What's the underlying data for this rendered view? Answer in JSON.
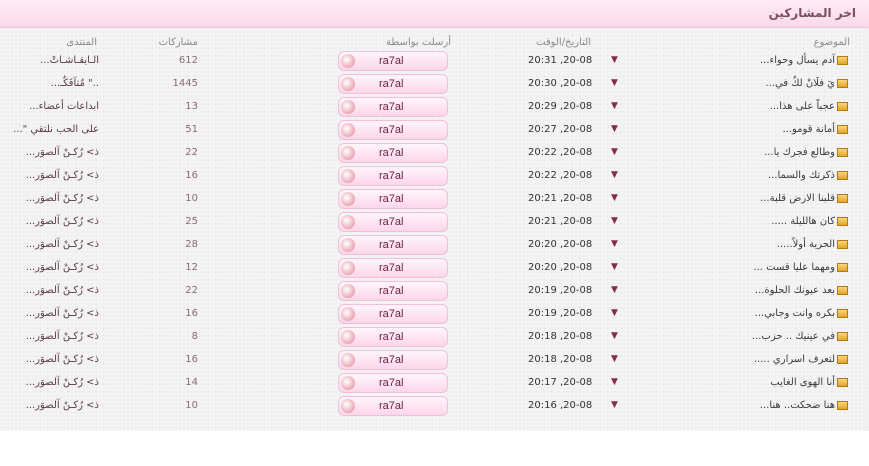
{
  "title": "اخر المشاركين",
  "headers": {
    "topic": "الموضوع",
    "datetime": "التاريخ/الوقت",
    "sent_by": "أرسلت بواسطة",
    "posts": "مشاركات",
    "forum": "المنتدى"
  },
  "rows": [
    {
      "topic": "آدم يسأل وحواء...",
      "date": "20:31 ,20-08",
      "user": "ra7al",
      "posts": "612",
      "forum": "الـايقـاشـاتْ..."
    },
    {
      "topic": "يَ فلَانْ لكٌ في...",
      "date": "20:30 ,20-08",
      "user": "ra7al",
      "posts": "1445",
      "forum": "..\" مٌتآفَكٌـ..."
    },
    {
      "topic": "عجباً على هذا...",
      "date": "20:29 ,20-08",
      "user": "ra7al",
      "posts": "13",
      "forum": "ابداعات أعضاء..."
    },
    {
      "topic": "أمانة قومو...",
      "date": "20:27 ,20-08",
      "user": "ra7al",
      "posts": "51",
      "forum": "على الحب نلتقي \"..."
    },
    {
      "topic": "وطالع فجرك يا...",
      "date": "20:22 ,20-08",
      "user": "ra7al",
      "posts": "22",
      "forum": "ذ> رُكـنْ آلصوَر..."
    },
    {
      "topic": "ذكرتك والسما...",
      "date": "20:22 ,20-08",
      "user": "ra7al",
      "posts": "16",
      "forum": "ذ> رُكـنْ آلصوَر..."
    },
    {
      "topic": "قلبنا الارض قلبة...",
      "date": "20:21 ,20-08",
      "user": "ra7al",
      "posts": "10",
      "forum": "ذ> رُكـنْ آلصوَر..."
    },
    {
      "topic": "كان هالليلة .....",
      "date": "20:21 ,20-08",
      "user": "ra7al",
      "posts": "25",
      "forum": "ذ> رُكـنْ آلصوَر..."
    },
    {
      "topic": "الحرية أولاً.....",
      "date": "20:20 ,20-08",
      "user": "ra7al",
      "posts": "28",
      "forum": "ذ> رُكـنْ آلصوَر..."
    },
    {
      "topic": "ومهما عليا قست ...",
      "date": "20:20 ,20-08",
      "user": "ra7al",
      "posts": "12",
      "forum": "ذ> رُكـنْ آلصوَر..."
    },
    {
      "topic": "بعد عيونك الحلوة...",
      "date": "20:19 ,20-08",
      "user": "ra7al",
      "posts": "22",
      "forum": "ذ> رُكـنْ آلصوَر..."
    },
    {
      "topic": "بكره وانت وجابي...",
      "date": "20:19 ,20-08",
      "user": "ra7al",
      "posts": "16",
      "forum": "ذ> رُكـنْ آلصوَر..."
    },
    {
      "topic": "في عينيك .. حزب...",
      "date": "20:18 ,20-08",
      "user": "ra7al",
      "posts": "8",
      "forum": "ذ> رُكـنْ آلصوَر..."
    },
    {
      "topic": "لتعرف اسراري .....",
      "date": "20:18 ,20-08",
      "user": "ra7al",
      "posts": "16",
      "forum": "ذ> رُكـنْ آلصوَر..."
    },
    {
      "topic": "أنا الهوى الغايب",
      "date": "20:17 ,20-08",
      "user": "ra7al",
      "posts": "14",
      "forum": "ذ> رُكـنْ آلصوَر..."
    },
    {
      "topic": "هنا ضحكت.. هنا...",
      "date": "20:16 ,20-08",
      "user": "ra7al",
      "posts": "10",
      "forum": "ذ> رُكـنْ آلصوَر..."
    }
  ],
  "arrow_glyph": "▼",
  "icons": {
    "topic": "folder-icon",
    "latest": "arrow-down-icon",
    "user": "avatar-icon"
  },
  "colors": {
    "title_bar": "#fbd9ea",
    "pill": "#fcd6ea",
    "accent": "#8a2a4a"
  }
}
